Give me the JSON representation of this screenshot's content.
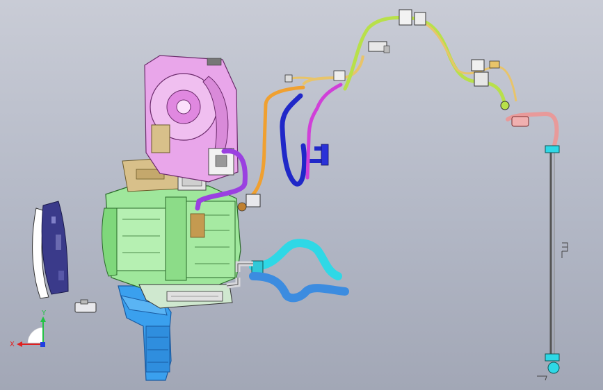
{
  "viewport": {
    "background_top": "#c9ccd6",
    "background_bottom": "#a2a7b6"
  },
  "triad": {
    "y_label": "Y",
    "x_label": "X",
    "y_color": "#22c244",
    "x_color": "#e02020",
    "z_color": "#2040e0"
  },
  "colors": {
    "blower_pink": "#e9a6ea",
    "hvac_green": "#9fe79c",
    "duct_blue": "#3aa0ee",
    "hose_cyan": "#2fd8e6",
    "hose_blue": "#3c8ce0",
    "pipe_yellow": "#e8c46a",
    "pipe_lime": "#b8e04a",
    "pipe_magenta": "#d040d8",
    "pipe_navy": "#2028c8",
    "pipe_purple": "#9a40e0",
    "drain_pink": "#e89a9a",
    "cluster_navy": "#3a3a8a"
  }
}
